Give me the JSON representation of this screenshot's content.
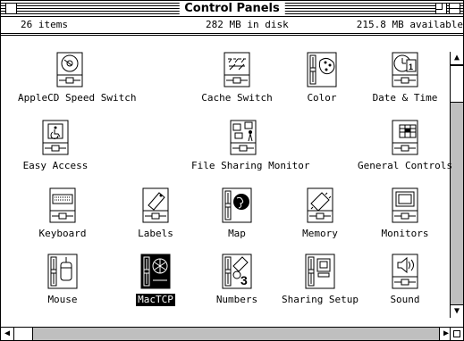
{
  "window": {
    "title": "Control Panels",
    "info": {
      "items": "26 items",
      "disk": "282 MB in disk",
      "available": "215.8 MB available"
    }
  },
  "panels": [
    {
      "label": "AppleCD Speed Switch",
      "icon": "cd-icon"
    },
    {
      "label": "Cache Switch",
      "icon": "cache-icon"
    },
    {
      "label": "Color",
      "icon": "color-palette-icon"
    },
    {
      "label": "Date & Time",
      "icon": "clock-calendar-icon"
    },
    {
      "label": "Easy Access",
      "icon": "accessibility-icon"
    },
    {
      "label": "File Sharing Monitor",
      "icon": "network-monitor-icon"
    },
    {
      "label": "General Controls",
      "icon": "general-controls-icon"
    },
    {
      "label": "Keyboard",
      "icon": "keyboard-icon"
    },
    {
      "label": "Labels",
      "icon": "tag-icon"
    },
    {
      "label": "Map",
      "icon": "globe-icon"
    },
    {
      "label": "Memory",
      "icon": "memory-chip-icon"
    },
    {
      "label": "Monitors",
      "icon": "monitor-icon"
    },
    {
      "label": "Mouse",
      "icon": "mouse-icon"
    },
    {
      "label": "MacTCP",
      "icon": "network-tcp-icon",
      "selected": true
    },
    {
      "label": "Numbers",
      "icon": "numbers-icon"
    },
    {
      "label": "Sharing Setup",
      "icon": "sharing-setup-icon"
    },
    {
      "label": "Sound",
      "icon": "speaker-icon"
    }
  ]
}
